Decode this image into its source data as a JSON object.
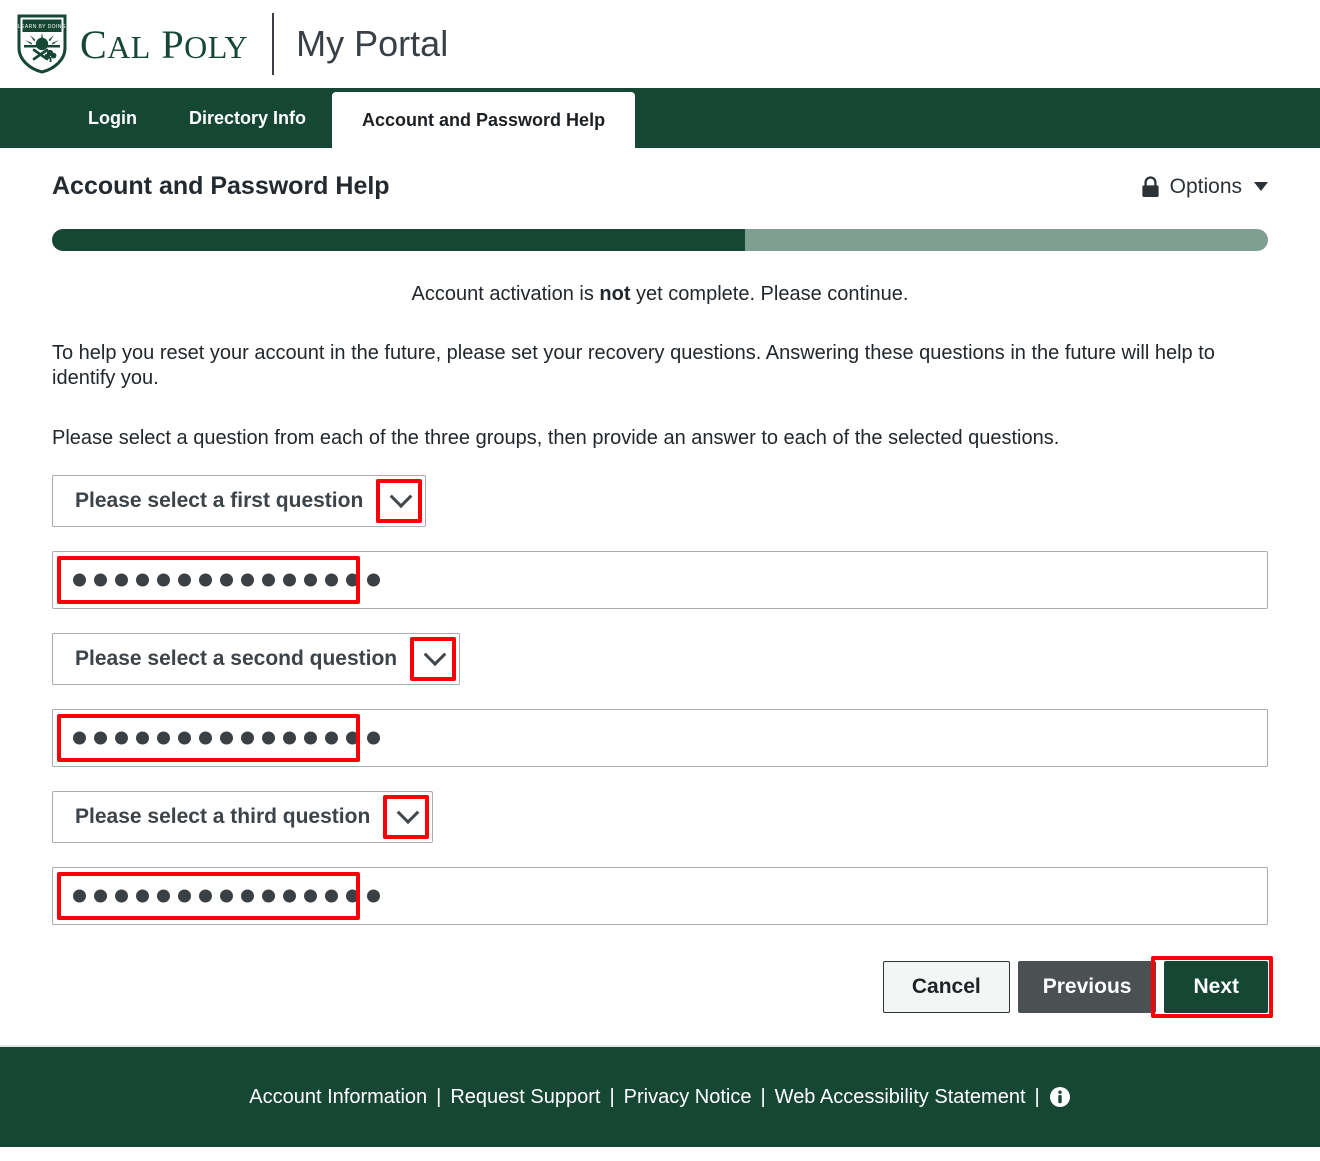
{
  "header": {
    "logo_icon": "cal-poly-shield-icon",
    "wordmark_cal": "C",
    "wordmark_cal_rest": "AL",
    "wordmark_poly": "P",
    "wordmark_poly_rest": "OLY",
    "subtitle": "My Portal"
  },
  "nav": {
    "items": [
      {
        "label": "Login",
        "active": false
      },
      {
        "label": "Directory Info",
        "active": false
      },
      {
        "label": "Account and Password Help",
        "active": true
      }
    ]
  },
  "page": {
    "title": "Account and Password Help",
    "options_label": "Options",
    "options_icon": "lock-icon",
    "caret_icon": "chevron-down-icon"
  },
  "progress": {
    "percent": 57,
    "fill_color": "#154734",
    "track_color": "#7f9f93"
  },
  "content": {
    "status_prefix": "Account activation is ",
    "status_emphasis": "not",
    "status_suffix": " yet complete. Please continue.",
    "paragraph_1": "To help you reset your account in the future, please set your recovery questions. Answering these questions in the future will help to identify you.",
    "paragraph_2": "Please select a question from each of the three groups, then provide an answer to each of the selected questions."
  },
  "form": {
    "question_1_label": "Please select a first question",
    "answer_1_dots": 15,
    "question_2_label": "Please select a second question",
    "answer_2_dots": 15,
    "question_3_label": "Please select a third question",
    "answer_3_dots": 15
  },
  "buttons": {
    "cancel_label": "Cancel",
    "previous_label": "Previous",
    "next_label": "Next"
  },
  "annotations": {
    "highlight_color": "#fb0007"
  },
  "footer": {
    "links": [
      "Account Information",
      "Request Support",
      "Privacy Notice",
      "Web Accessibility Statement"
    ],
    "separator": "|",
    "info_icon": "info-circle-icon"
  }
}
